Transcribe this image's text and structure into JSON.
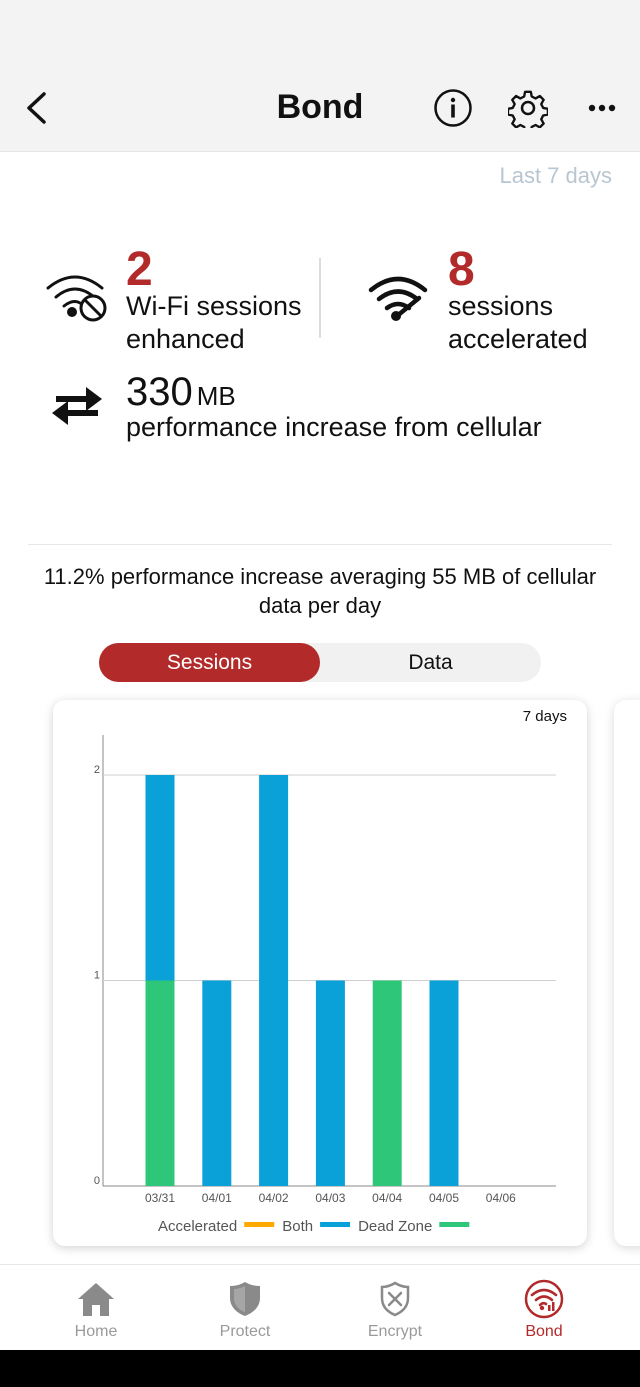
{
  "header": {
    "title": "Bond"
  },
  "period_label": "Last 7 days",
  "stats": {
    "wifi": {
      "value": "2",
      "label_line1": "Wi-Fi sessions",
      "label_line2": "enhanced"
    },
    "accelerated": {
      "value": "8",
      "label_line1": "sessions",
      "label_line2": "accelerated"
    },
    "data": {
      "value": "330",
      "unit": "MB",
      "label": "performance increase from cellular"
    }
  },
  "summary": "11.2% performance increase averaging 55 MB of cellular data per day",
  "segment": {
    "active": "Sessions",
    "inactive": "Data"
  },
  "chart_period": "7 days",
  "colors": {
    "brand": "#b22a2a",
    "both": "#0aa0d8",
    "dead_zone": "#2ec77a",
    "accelerated": "#ffa800"
  },
  "chart_data": {
    "type": "bar",
    "stacked": true,
    "categories": [
      "03/31",
      "04/01",
      "04/02",
      "04/03",
      "04/04",
      "04/05",
      "04/06"
    ],
    "series": [
      {
        "name": "Accelerated",
        "color": "#ffa800",
        "values": [
          0,
          0,
          0,
          0,
          0,
          0,
          0
        ]
      },
      {
        "name": "Both",
        "color": "#0aa0d8",
        "values": [
          1,
          1,
          2,
          1,
          0,
          1,
          0
        ]
      },
      {
        "name": "Dead Zone",
        "color": "#2ec77a",
        "values": [
          1,
          0,
          0,
          0,
          1,
          0,
          0
        ]
      }
    ],
    "y_ticks": [
      "0",
      "1",
      "2"
    ],
    "ylim": [
      0,
      2
    ],
    "grid": true,
    "legend_position": "bottom"
  },
  "tabs": [
    {
      "label": "Home",
      "icon": "home-icon"
    },
    {
      "label": "Protect",
      "icon": "shield-icon"
    },
    {
      "label": "Encrypt",
      "icon": "encrypt-shield-icon"
    },
    {
      "label": "Bond",
      "icon": "bond-wifi-icon",
      "active": true
    }
  ]
}
